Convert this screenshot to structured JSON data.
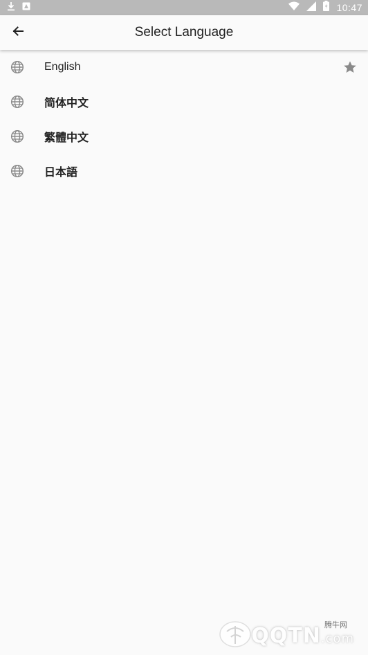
{
  "status_bar": {
    "time": "10:47",
    "left_icons": [
      "download-icon",
      "notification-app-icon"
    ],
    "right_icons": [
      "wifi-icon",
      "signal-icon",
      "battery-icon"
    ]
  },
  "app_bar": {
    "title": "Select Language",
    "back_icon": "arrow-left-icon"
  },
  "languages": [
    {
      "label": "English",
      "icon": "globe-icon",
      "starred": true
    },
    {
      "label": "简体中文",
      "icon": "globe-icon",
      "starred": false
    },
    {
      "label": "繁體中文",
      "icon": "globe-icon",
      "starred": false
    },
    {
      "label": "日本語",
      "icon": "globe-icon",
      "starred": false
    }
  ],
  "watermark": {
    "site_cn": "腾牛网",
    "brand": "QQTN",
    "domain_suffix": ".com"
  },
  "colors": {
    "status_bar_bg": "#b9b9b9",
    "background": "#fafafa",
    "text": "#222222",
    "icon_gray": "#8a8a8a"
  }
}
